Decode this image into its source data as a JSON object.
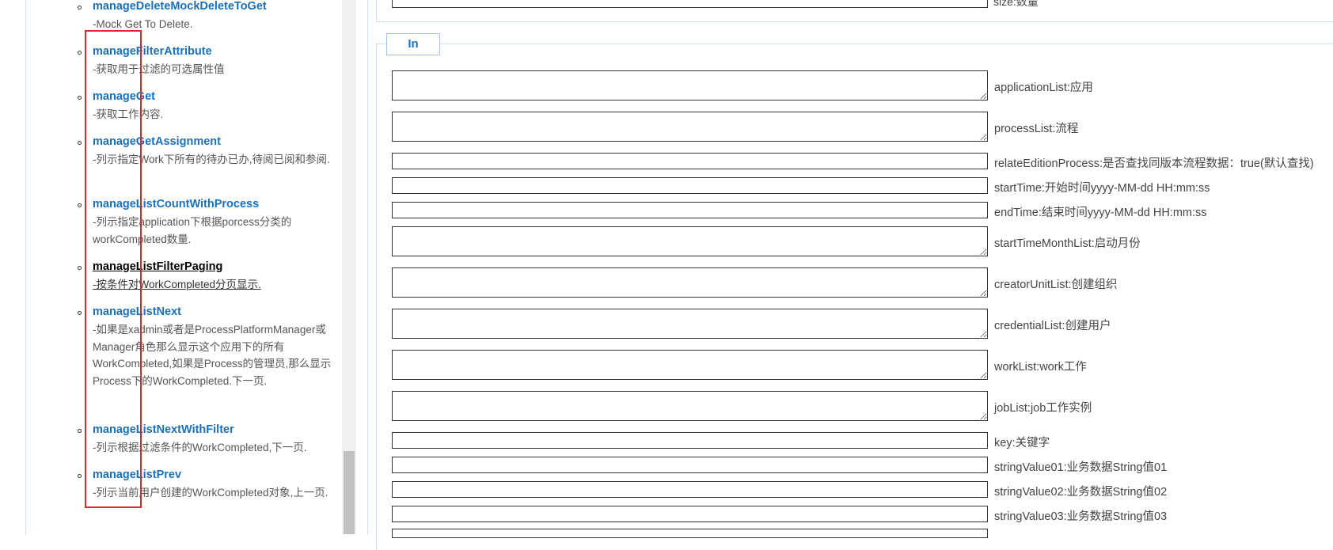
{
  "sidebar": {
    "items": [
      {
        "name": "manageDeleteMockDeleteToGet",
        "desc": "-Mock Get To Delete.",
        "active": false
      },
      {
        "name": "manageFilterAttribute",
        "desc": "-获取用于过滤的可选属性值",
        "active": false
      },
      {
        "name": "manageGet",
        "desc": "-获取工作内容.",
        "active": false
      },
      {
        "name": "manageGetAssignment",
        "desc": "-列示指定Work下所有的待办已办,待阅已阅和参阅.",
        "active": false
      },
      {
        "name": "manageListCountWithProcess",
        "desc": "-列示指定application下根据porcess分类的workCompleted数量.",
        "active": false
      },
      {
        "name": "manageListFilterPaging",
        "desc": "-按条件对WorkCompleted分页显示.",
        "active": true
      },
      {
        "name": "manageListNext",
        "desc": "-如果是xadmin或者是ProcessPlatformManager或Manager角色那么显示这个应用下的所有WorkCompleted,如果是Process的管理员,那么显示Process下的WorkCompleted.下一页.",
        "active": false
      },
      {
        "name": "manageListNextWithFilter",
        "desc": "-列示根据过滤条件的WorkCompleted,下一页.",
        "active": false
      },
      {
        "name": "manageListPrev",
        "desc": "-列示当前用户创建的WorkCompleted对象,上一页.",
        "active": false
      }
    ]
  },
  "top_section": {
    "label": "size:数量"
  },
  "in_section": {
    "tab_label": "In",
    "fields": [
      {
        "label": "applicationList:应用",
        "type": "textarea"
      },
      {
        "label": "processList:流程",
        "type": "textarea"
      },
      {
        "label": "relateEditionProcess:是否查找同版本流程数据：true(默认查找)",
        "type": "input"
      },
      {
        "label": "startTime:开始时间yyyy-MM-dd HH:mm:ss",
        "type": "input"
      },
      {
        "label": "endTime:结束时间yyyy-MM-dd HH:mm:ss",
        "type": "input"
      },
      {
        "label": "startTimeMonthList:启动月份",
        "type": "textarea"
      },
      {
        "label": "creatorUnitList:创建组织",
        "type": "textarea"
      },
      {
        "label": "credentialList:创建用户",
        "type": "textarea"
      },
      {
        "label": "workList:work工作",
        "type": "textarea"
      },
      {
        "label": "jobList:job工作实例",
        "type": "textarea"
      },
      {
        "label": "key:关键字",
        "type": "input"
      },
      {
        "label": "stringValue01:业务数据String值01",
        "type": "input"
      },
      {
        "label": "stringValue02:业务数据String值02",
        "type": "input"
      },
      {
        "label": "stringValue03:业务数据String值03",
        "type": "input"
      }
    ]
  },
  "colors": {
    "link": "#1a70b8",
    "highlight": "#e0242b",
    "border": "#cfdff0"
  }
}
